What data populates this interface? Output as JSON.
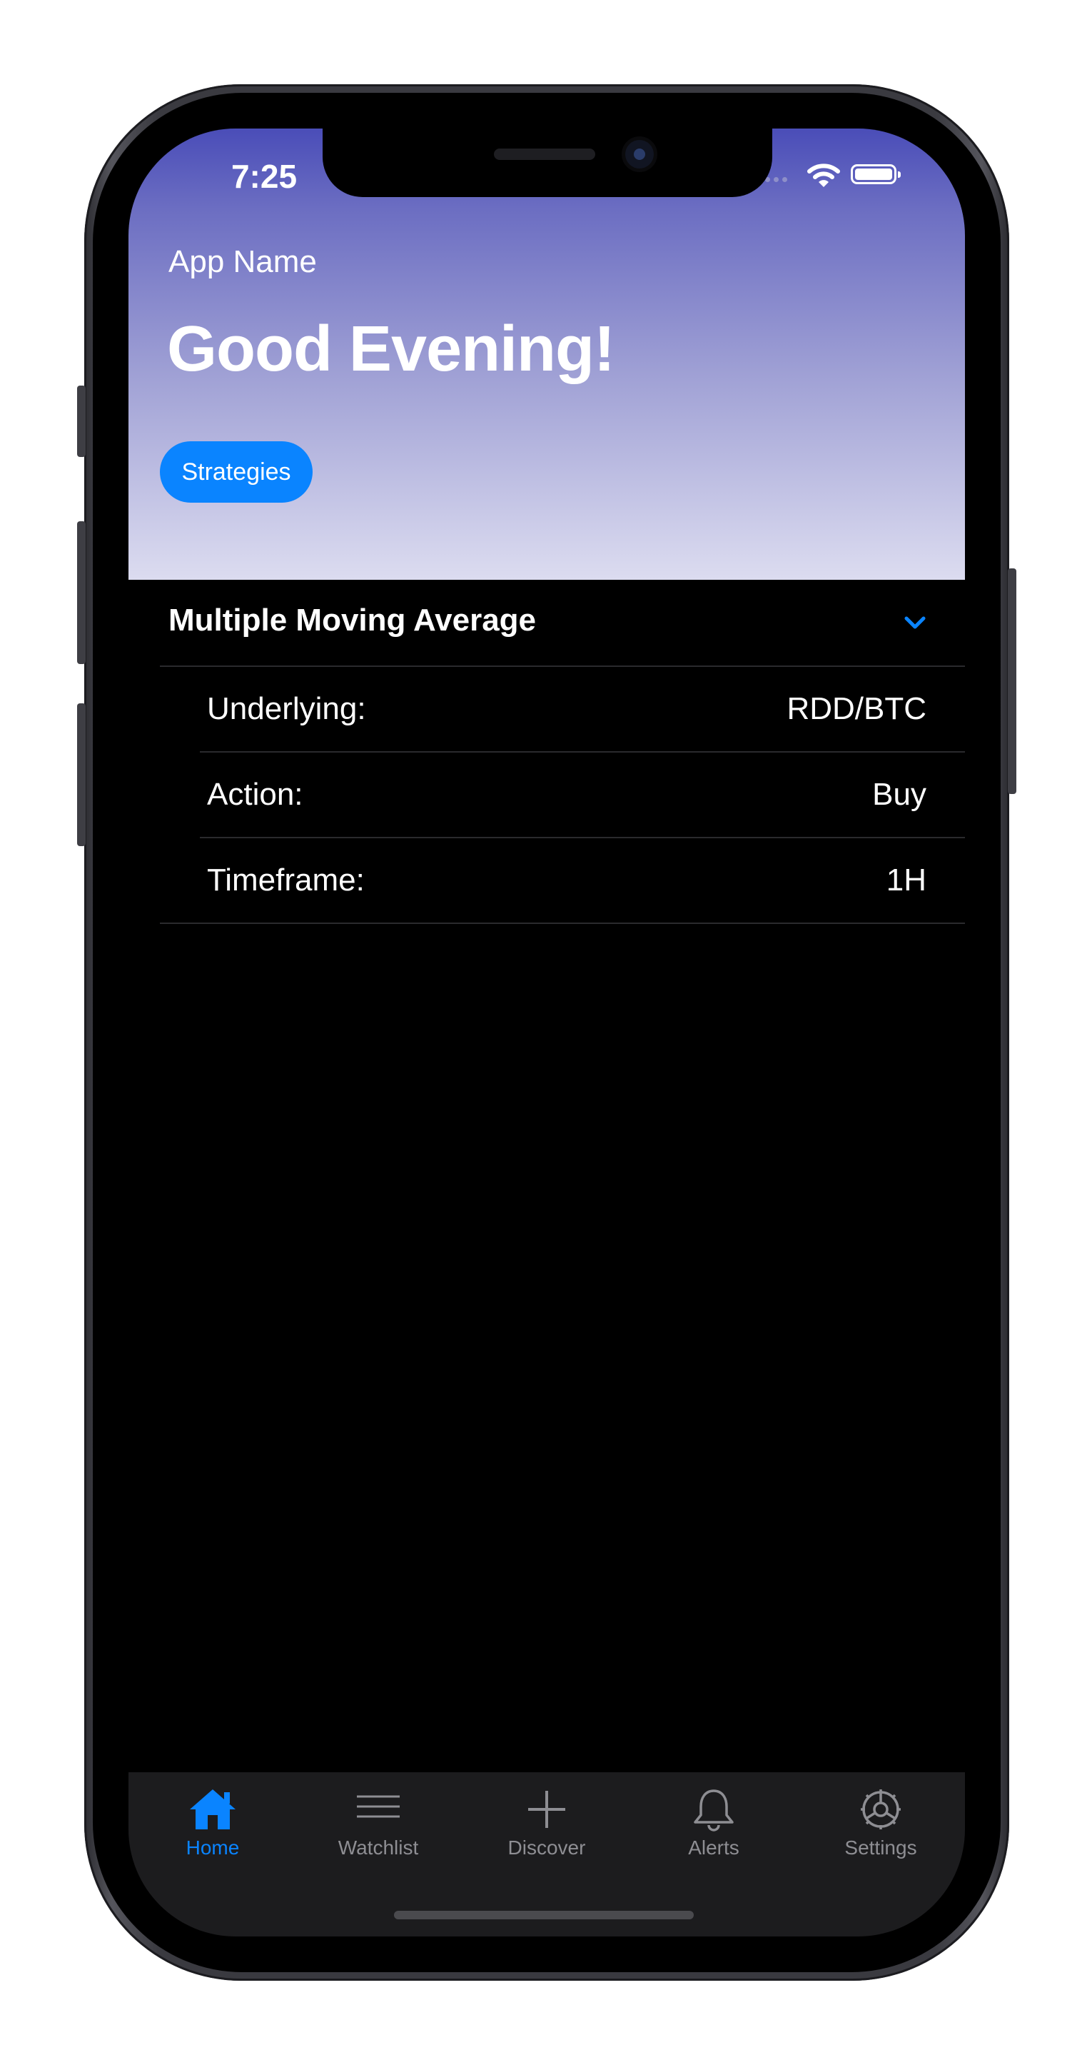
{
  "status_bar": {
    "time": "7:25",
    "icons": [
      "signal-dots-icon",
      "wifi-icon",
      "battery-icon"
    ]
  },
  "header": {
    "app_name": "App Name",
    "greeting": "Good Evening!",
    "chip_label": "Strategies"
  },
  "strategy": {
    "title": "Multiple Moving Average",
    "expanded_icon": "chevron-down-icon",
    "rows": [
      {
        "label": "Underlying:",
        "value": "RDD/BTC"
      },
      {
        "label": "Action:",
        "value": "Buy"
      },
      {
        "label": "Timeframe:",
        "value": "1H"
      }
    ]
  },
  "tabbar": {
    "items": [
      {
        "label": "Home",
        "icon": "house-icon",
        "active": true
      },
      {
        "label": "Watchlist",
        "icon": "list-lines-icon",
        "active": false
      },
      {
        "label": "Discover",
        "icon": "plus-icon",
        "active": false
      },
      {
        "label": "Alerts",
        "icon": "bell-icon",
        "active": false
      },
      {
        "label": "Settings",
        "icon": "gear-icon",
        "active": false
      }
    ]
  },
  "colors": {
    "accent": "#0a84ff",
    "header_gradient_top": "#4a4db8",
    "header_gradient_bottom": "#dcdcf0",
    "background": "#000000",
    "tabbar_background": "#1c1c1e",
    "inactive_tab": "#8e8e93"
  }
}
